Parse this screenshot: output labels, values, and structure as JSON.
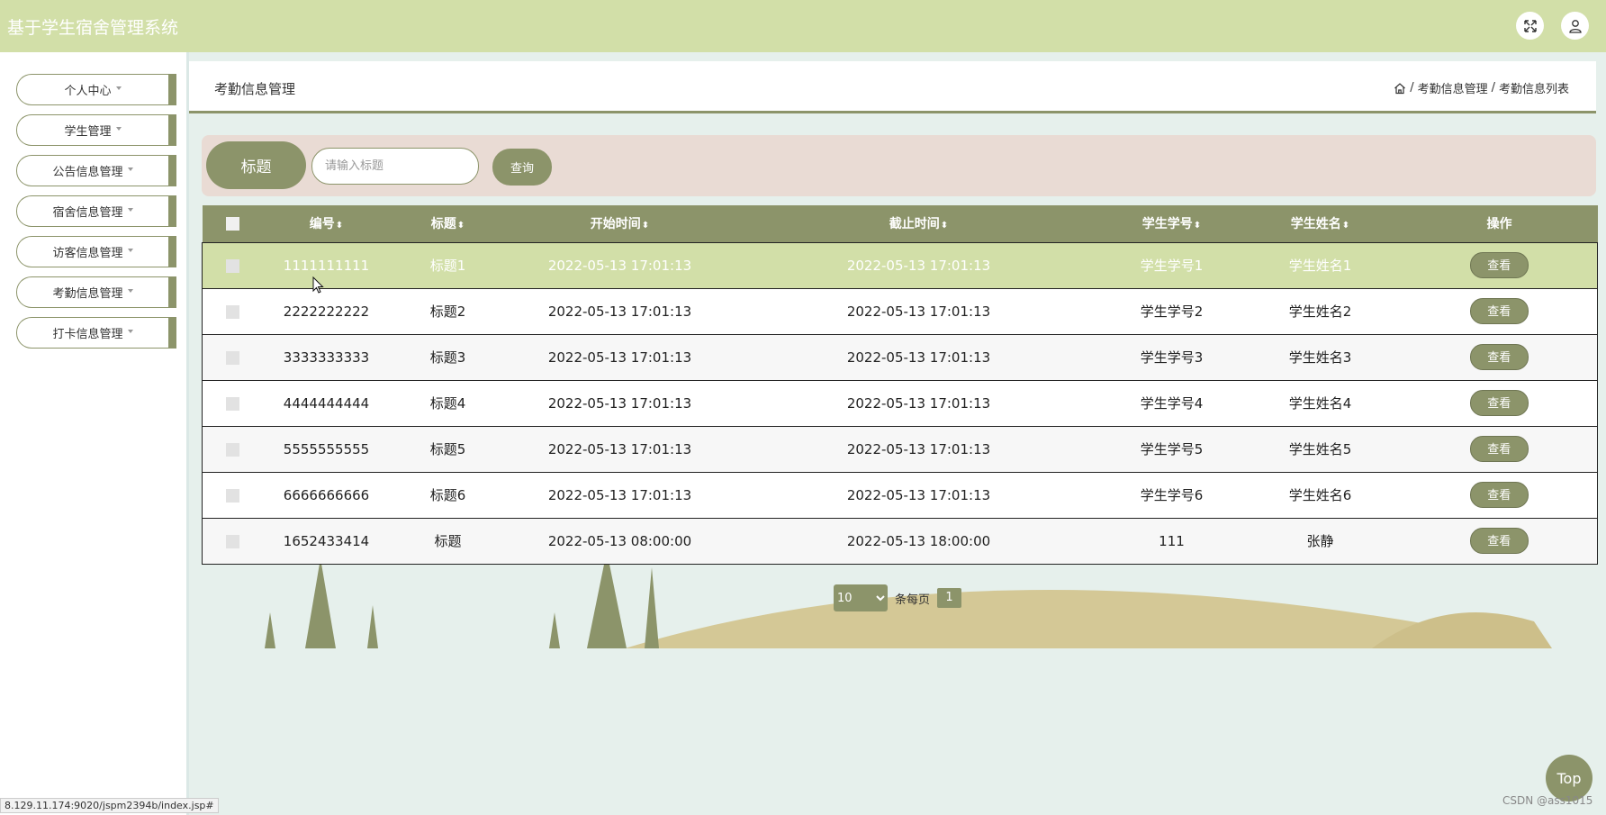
{
  "header": {
    "app_title": "基于学生宿舍管理系统",
    "fullscreen_icon": "fullscreen-icon",
    "user_icon": "user-icon"
  },
  "sidebar": {
    "items": [
      {
        "label": "个人中心"
      },
      {
        "label": "学生管理"
      },
      {
        "label": "公告信息管理"
      },
      {
        "label": "宿舍信息管理"
      },
      {
        "label": "访客信息管理"
      },
      {
        "label": "考勤信息管理"
      },
      {
        "label": "打卡信息管理"
      }
    ]
  },
  "breadcrumb": {
    "title": "考勤信息管理",
    "home_icon": "home-icon",
    "separator": "/",
    "level1": "考勤信息管理",
    "level2": "考勤信息列表"
  },
  "search": {
    "label": "标题",
    "placeholder": "请输入标题",
    "button": "查询"
  },
  "table": {
    "headers": [
      "编号",
      "标题",
      "开始时间",
      "截止时间",
      "学生学号",
      "学生姓名",
      "操作"
    ],
    "sort_glyph": "⬍",
    "rows": [
      {
        "id": "1111111111",
        "title": "标题1",
        "start": "2022-05-13 17:01:13",
        "end": "2022-05-13 17:01:13",
        "student_no": "学生学号1",
        "student_name": "学生姓名1",
        "action": "查看"
      },
      {
        "id": "2222222222",
        "title": "标题2",
        "start": "2022-05-13 17:01:13",
        "end": "2022-05-13 17:01:13",
        "student_no": "学生学号2",
        "student_name": "学生姓名2",
        "action": "查看"
      },
      {
        "id": "3333333333",
        "title": "标题3",
        "start": "2022-05-13 17:01:13",
        "end": "2022-05-13 17:01:13",
        "student_no": "学生学号3",
        "student_name": "学生姓名3",
        "action": "查看"
      },
      {
        "id": "4444444444",
        "title": "标题4",
        "start": "2022-05-13 17:01:13",
        "end": "2022-05-13 17:01:13",
        "student_no": "学生学号4",
        "student_name": "学生姓名4",
        "action": "查看"
      },
      {
        "id": "5555555555",
        "title": "标题5",
        "start": "2022-05-13 17:01:13",
        "end": "2022-05-13 17:01:13",
        "student_no": "学生学号5",
        "student_name": "学生姓名5",
        "action": "查看"
      },
      {
        "id": "6666666666",
        "title": "标题6",
        "start": "2022-05-13 17:01:13",
        "end": "2022-05-13 17:01:13",
        "student_no": "学生学号6",
        "student_name": "学生姓名6",
        "action": "查看"
      },
      {
        "id": "1652433414",
        "title": "标题",
        "start": "2022-05-13 08:00:00",
        "end": "2022-05-13 18:00:00",
        "student_no": "111",
        "student_name": "张静",
        "action": "查看"
      }
    ]
  },
  "pagination": {
    "page_size": "10",
    "page_size_options": [
      "10"
    ],
    "per_page_label": "条每页",
    "current_page": "1"
  },
  "top_button": "Top",
  "status_url": "8.129.11.174:9020/jspm2394b/index.jsp#",
  "watermark": "CSDN @ass1015",
  "colors": {
    "header_bg": "#d2dfa8",
    "accent": "#8c946a",
    "search_bar_bg": "#e9dbd4",
    "page_bg": "#e6f0ec",
    "highlight_row": "#d2dfa8"
  }
}
